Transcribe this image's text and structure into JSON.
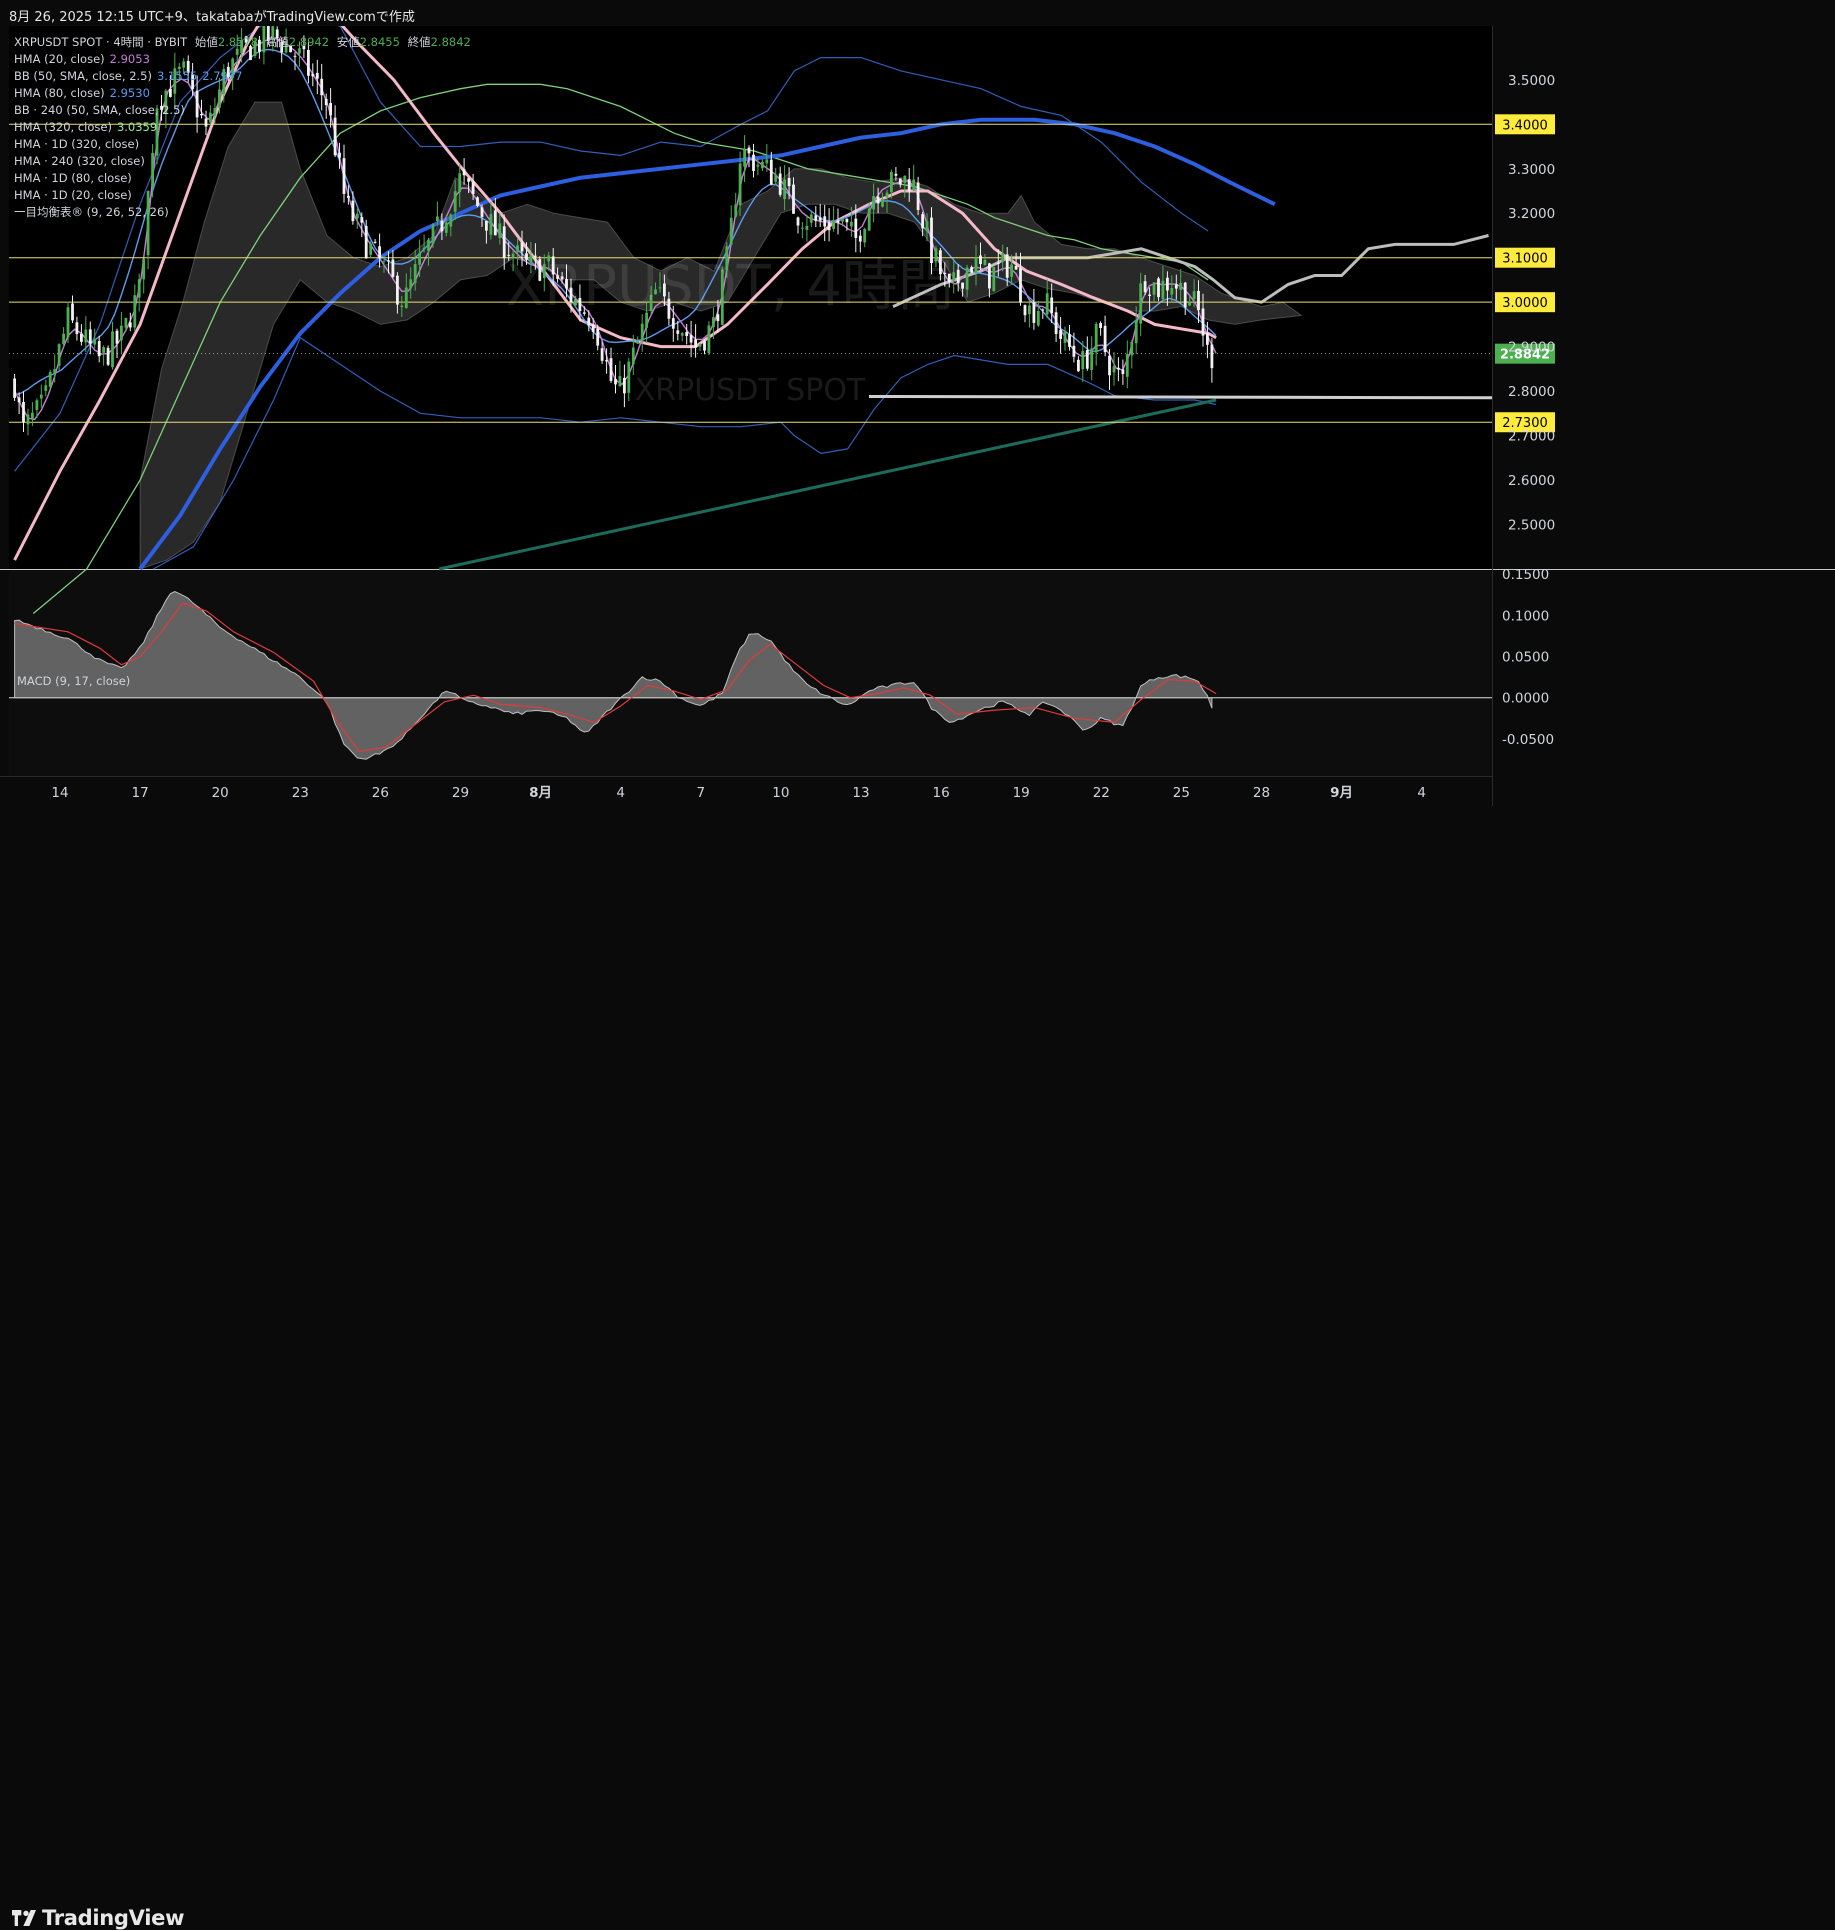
{
  "header": {
    "created_text": "8月 26, 2025 12:15 UTC+9、takatabaがTradingView.comで作成"
  },
  "watermark": {
    "line1": "XRPUSDT, 4時間",
    "line2": "XRPUSDT SPOT"
  },
  "legend": {
    "symbol": "XRPUSDT SPOT · 4時間 · BYBIT",
    "open_label": "始値",
    "open": "2.8578",
    "high_label": "高値",
    "high": "2.8942",
    "low_label": "安値",
    "low": "2.8455",
    "close_label": "終値",
    "close": "2.8842",
    "indicators": [
      {
        "name": "HMA (20, close)",
        "value": "2.9053",
        "color": "#c77dd7"
      },
      {
        "name": "BB (50, SMA, close, 2.5)",
        "value": "3.1555",
        "value2": "2.7977",
        "color": "#5b9cf0"
      },
      {
        "name": "HMA (80, close)",
        "value": "2.9530",
        "color": "#5b9cf0"
      },
      {
        "name": "BB · 240 (50, SMA, close, 2.5)",
        "value": "",
        "color": "#d1d4dc"
      },
      {
        "name": "HMA (320, close)",
        "value": "3.0359",
        "color": "#9fe89a"
      },
      {
        "name": "HMA · 1D (320, close)",
        "value": "",
        "color": "#d1d4dc"
      },
      {
        "name": "HMA · 240 (320, close)",
        "value": "",
        "color": "#d1d4dc"
      },
      {
        "name": "HMA · 1D (80, close)",
        "value": "",
        "color": "#d1d4dc"
      },
      {
        "name": "HMA · 1D (20, close)",
        "value": "",
        "color": "#d1d4dc"
      },
      {
        "name": "一目均衡表® (9, 26, 52, 26)",
        "value": "",
        "color": "#d1d4dc"
      }
    ]
  },
  "macd_legend": "MACD (9, 17, close)",
  "footer": {
    "brand": "TradingView"
  },
  "chart_data": [
    {
      "type": "candlestick",
      "title": "XRPUSDT SPOT · 4時間 · BYBIT",
      "ylim": [
        2.4,
        3.63
      ],
      "y_ticks": [
        "2.5000",
        "2.6000",
        "2.7000",
        "2.8000",
        "2.9000",
        "3.0000",
        "3.1000",
        "3.2000",
        "3.3000",
        "3.4000",
        "3.5000"
      ],
      "x_ticks": [
        "14",
        "17",
        "20",
        "23",
        "26",
        "29",
        "8月",
        "4",
        "7",
        "10",
        "13",
        "16",
        "19",
        "22",
        "25",
        "28",
        "9月",
        "4"
      ],
      "x_tick_days": [
        0,
        3,
        6,
        9,
        12,
        15,
        18,
        21,
        24,
        27,
        30,
        33,
        36,
        39,
        42,
        45,
        48,
        51
      ],
      "horizontal_levels": [
        {
          "value": 3.4,
          "label": "3.4000"
        },
        {
          "value": 3.1,
          "label": "3.1000"
        },
        {
          "value": 3.0,
          "label": "3.0000"
        },
        {
          "value": 2.73,
          "label": "2.7300"
        }
      ],
      "last_price": {
        "value": 2.8842,
        "label": "2.8842",
        "color": "#4caf50"
      },
      "close_path_keypoints": [
        [
          -1.7,
          2.82
        ],
        [
          -1.4,
          2.71
        ],
        [
          -0.6,
          2.77
        ],
        [
          0.3,
          2.96
        ],
        [
          1.5,
          2.87
        ],
        [
          2.3,
          2.92
        ],
        [
          3.0,
          3.03
        ],
        [
          3.6,
          3.45
        ],
        [
          4.6,
          3.52
        ],
        [
          5.5,
          3.38
        ],
        [
          6.2,
          3.52
        ],
        [
          7.0,
          3.57
        ],
        [
          8.0,
          3.6
        ],
        [
          9.0,
          3.55
        ],
        [
          10.0,
          3.45
        ],
        [
          10.7,
          3.22
        ],
        [
          11.5,
          3.13
        ],
        [
          12.2,
          3.07
        ],
        [
          12.9,
          3.0
        ],
        [
          13.4,
          3.08
        ],
        [
          14.3,
          3.18
        ],
        [
          15.0,
          3.28
        ],
        [
          15.6,
          3.22
        ],
        [
          16.5,
          3.14
        ],
        [
          17.5,
          3.08
        ],
        [
          18.3,
          3.08
        ],
        [
          19.0,
          3.02
        ],
        [
          20.0,
          2.96
        ],
        [
          20.7,
          2.81
        ],
        [
          21.0,
          2.8
        ],
        [
          21.6,
          2.9
        ],
        [
          22.3,
          3.02
        ],
        [
          23.0,
          2.97
        ],
        [
          23.8,
          2.9
        ],
        [
          24.5,
          2.95
        ],
        [
          25.0,
          3.1
        ],
        [
          25.5,
          3.34
        ],
        [
          26.4,
          3.3
        ],
        [
          26.9,
          3.28
        ],
        [
          27.6,
          3.2
        ],
        [
          28.3,
          3.18
        ],
        [
          29.2,
          3.18
        ],
        [
          29.8,
          3.14
        ],
        [
          30.5,
          3.25
        ],
        [
          31.3,
          3.27
        ],
        [
          31.9,
          3.28
        ],
        [
          32.6,
          3.12
        ],
        [
          33.3,
          3.02
        ],
        [
          34.1,
          3.09
        ],
        [
          34.8,
          3.06
        ],
        [
          35.6,
          3.09
        ],
        [
          36.3,
          2.98
        ],
        [
          36.9,
          3.0
        ],
        [
          37.5,
          2.92
        ],
        [
          38.3,
          2.86
        ],
        [
          38.9,
          2.93
        ],
        [
          39.4,
          2.85
        ],
        [
          39.8,
          2.82
        ],
        [
          40.2,
          2.95
        ],
        [
          40.6,
          3.06
        ],
        [
          41.1,
          3.03
        ],
        [
          41.6,
          3.05
        ],
        [
          42.2,
          3.02
        ],
        [
          42.7,
          2.97
        ],
        [
          43.0,
          2.88
        ],
        [
          43.3,
          2.88
        ]
      ]
    },
    {
      "type": "line",
      "title": "MACD (9, 17, close)",
      "ylim": [
        -0.095,
        0.155
      ],
      "y_ticks": [
        "0.1500",
        "0.1000",
        "0.0500",
        "0.0000",
        "-0.0500"
      ],
      "histogram_keypoints": [
        [
          -1.7,
          0.095
        ],
        [
          0.3,
          0.072
        ],
        [
          1.5,
          0.045
        ],
        [
          2.3,
          0.035
        ],
        [
          3.0,
          0.06
        ],
        [
          3.5,
          0.09
        ],
        [
          4.2,
          0.132
        ],
        [
          5.0,
          0.115
        ],
        [
          6.0,
          0.085
        ],
        [
          7.0,
          0.065
        ],
        [
          8.0,
          0.045
        ],
        [
          9.0,
          0.025
        ],
        [
          10.0,
          -0.005
        ],
        [
          10.6,
          -0.055
        ],
        [
          11.2,
          -0.075
        ],
        [
          12.0,
          -0.068
        ],
        [
          12.8,
          -0.05
        ],
        [
          13.6,
          -0.02
        ],
        [
          14.5,
          0.01
        ],
        [
          15.2,
          -0.005
        ],
        [
          16.0,
          -0.01
        ],
        [
          17.0,
          -0.02
        ],
        [
          18.0,
          -0.015
        ],
        [
          19.0,
          -0.025
        ],
        [
          19.7,
          -0.045
        ],
        [
          20.4,
          -0.02
        ],
        [
          21.2,
          0.005
        ],
        [
          21.8,
          0.025
        ],
        [
          22.5,
          0.02
        ],
        [
          23.2,
          0.0
        ],
        [
          24.0,
          -0.01
        ],
        [
          24.8,
          0.005
        ],
        [
          25.4,
          0.055
        ],
        [
          25.9,
          0.08
        ],
        [
          26.6,
          0.07
        ],
        [
          27.4,
          0.035
        ],
        [
          28.0,
          0.015
        ],
        [
          28.7,
          0.002
        ],
        [
          29.5,
          -0.01
        ],
        [
          30.4,
          0.01
        ],
        [
          31.2,
          0.015
        ],
        [
          32.0,
          0.02
        ],
        [
          32.7,
          -0.015
        ],
        [
          33.4,
          -0.03
        ],
        [
          34.4,
          -0.015
        ],
        [
          35.3,
          -0.005
        ],
        [
          36.3,
          -0.02
        ],
        [
          36.9,
          -0.005
        ],
        [
          37.5,
          -0.015
        ],
        [
          38.4,
          -0.04
        ],
        [
          39.0,
          -0.025
        ],
        [
          39.8,
          -0.035
        ],
        [
          40.5,
          0.015
        ],
        [
          41.1,
          0.025
        ],
        [
          41.8,
          0.027
        ],
        [
          42.6,
          0.022
        ],
        [
          43.0,
          0.0
        ],
        [
          43.3,
          -0.025
        ]
      ],
      "signal_keypoints": [
        [
          -1.7,
          0.09
        ],
        [
          0.3,
          0.08
        ],
        [
          1.5,
          0.06
        ],
        [
          2.3,
          0.04
        ],
        [
          3.0,
          0.05
        ],
        [
          3.8,
          0.08
        ],
        [
          4.6,
          0.115
        ],
        [
          5.5,
          0.105
        ],
        [
          6.5,
          0.08
        ],
        [
          8.0,
          0.055
        ],
        [
          9.5,
          0.02
        ],
        [
          10.4,
          -0.03
        ],
        [
          11.2,
          -0.065
        ],
        [
          12.2,
          -0.06
        ],
        [
          13.2,
          -0.035
        ],
        [
          14.4,
          -0.005
        ],
        [
          15.5,
          0.003
        ],
        [
          16.5,
          -0.008
        ],
        [
          18.0,
          -0.012
        ],
        [
          19.0,
          -0.02
        ],
        [
          20.0,
          -0.03
        ],
        [
          21.0,
          -0.01
        ],
        [
          22.0,
          0.015
        ],
        [
          23.0,
          0.008
        ],
        [
          24.0,
          -0.002
        ],
        [
          25.0,
          0.01
        ],
        [
          25.8,
          0.045
        ],
        [
          26.6,
          0.065
        ],
        [
          27.6,
          0.04
        ],
        [
          28.6,
          0.015
        ],
        [
          29.6,
          0.0
        ],
        [
          30.6,
          0.005
        ],
        [
          31.6,
          0.012
        ],
        [
          32.6,
          0.003
        ],
        [
          33.6,
          -0.02
        ],
        [
          35.0,
          -0.015
        ],
        [
          36.5,
          -0.012
        ],
        [
          38.0,
          -0.025
        ],
        [
          39.5,
          -0.03
        ],
        [
          40.5,
          -0.002
        ],
        [
          41.5,
          0.022
        ],
        [
          42.5,
          0.02
        ],
        [
          43.3,
          0.005
        ]
      ]
    }
  ]
}
